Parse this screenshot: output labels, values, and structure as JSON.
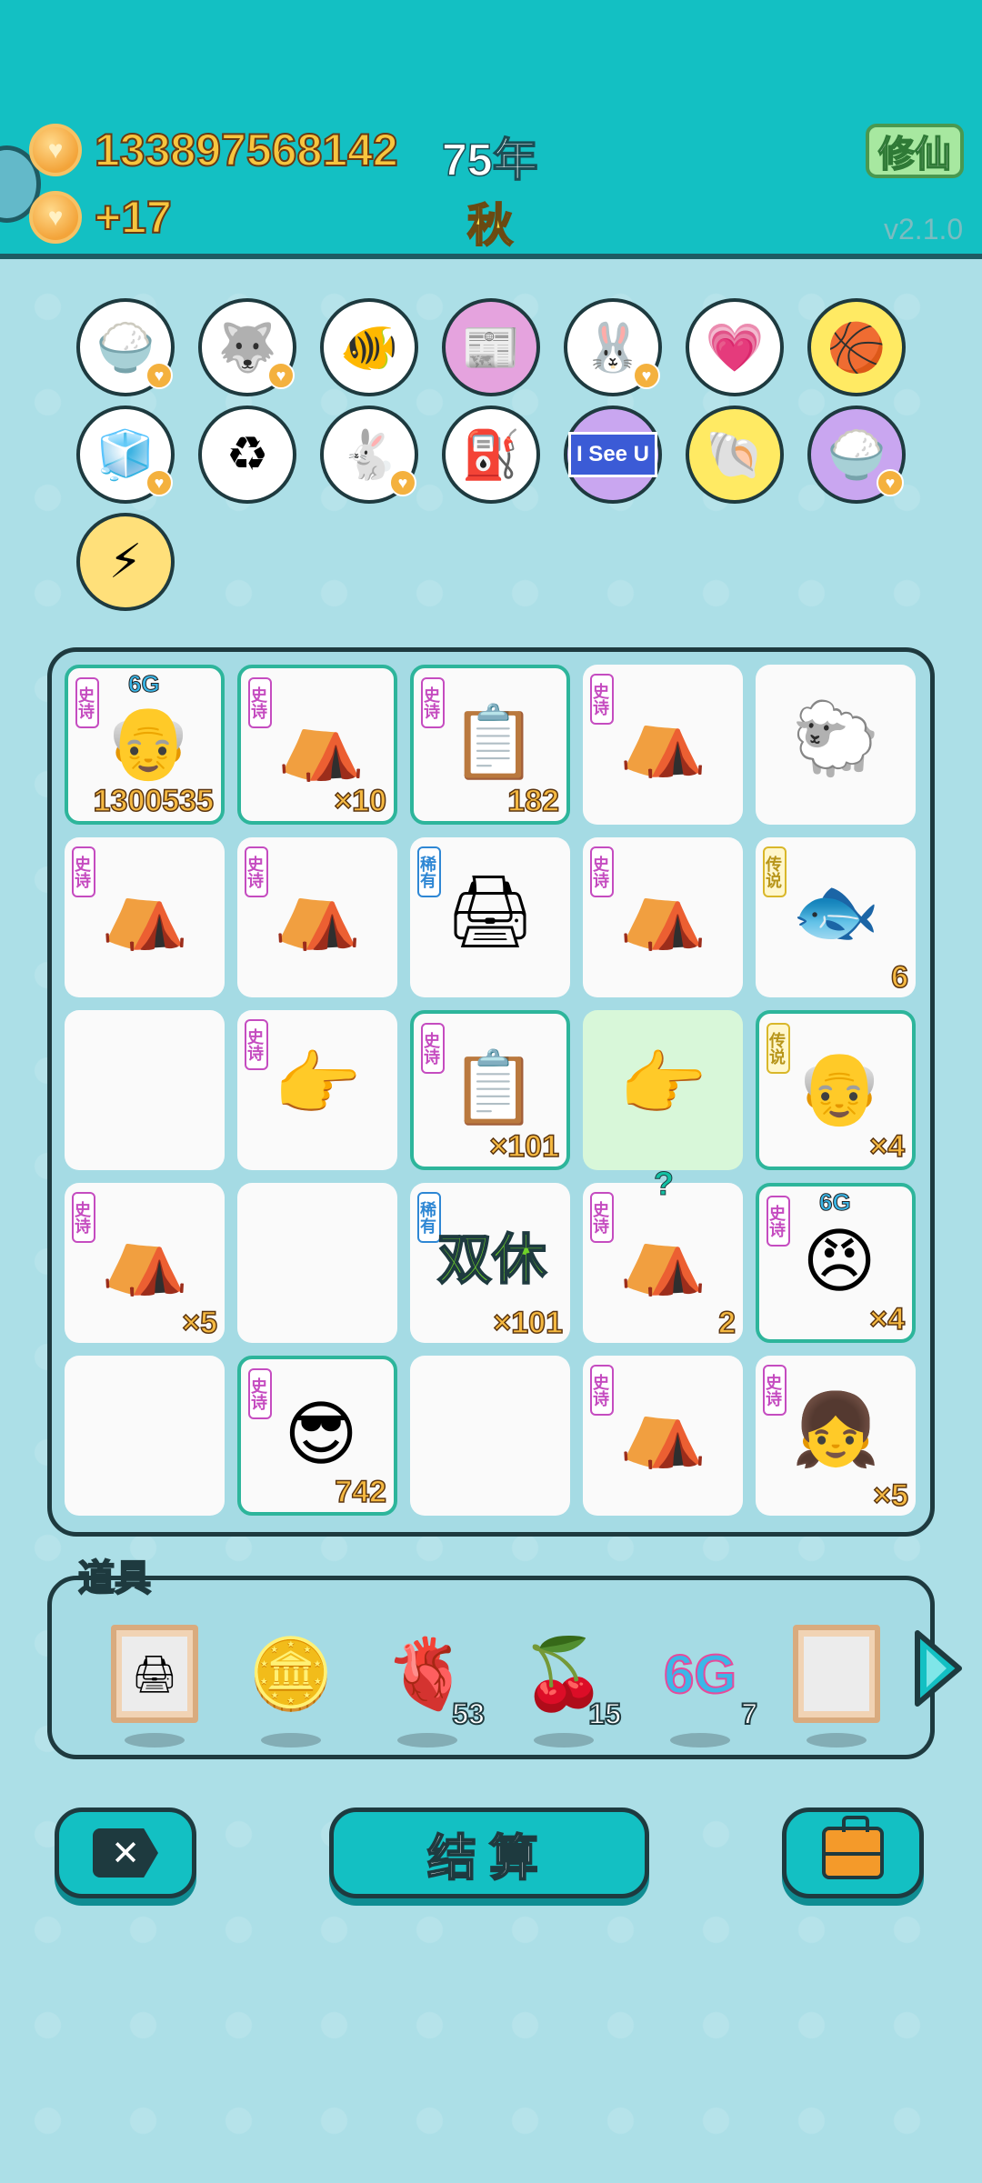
{
  "header": {
    "coins": "133897568142",
    "income": "+17",
    "year": "75年",
    "season": "秋",
    "cultivate_button": "修仙",
    "version": "v2.1.0"
  },
  "collection": [
    {
      "name": "rice-bowl-icon",
      "glyph": "🍚",
      "bg": "#ffffff",
      "heart": true
    },
    {
      "name": "husky-dog-icon",
      "glyph": "🐺",
      "bg": "#ffffff",
      "heart": true
    },
    {
      "name": "fish-tank-icon",
      "glyph": "🐠",
      "bg": "#ffffff",
      "heart": false
    },
    {
      "name": "time-magazine-icon",
      "glyph": "📰",
      "bg": "#e5a3de",
      "heart": false
    },
    {
      "name": "rabbit-icon",
      "glyph": "🐰",
      "bg": "#ffffff",
      "heart": true
    },
    {
      "name": "heart-fan-icon",
      "glyph": "💗",
      "bg": "#ffffff",
      "heart": false
    },
    {
      "name": "basketballs-icon",
      "glyph": "🏀",
      "bg": "#ffea63",
      "heart": false
    },
    {
      "name": "sugar-cubes-icon",
      "glyph": "🧊",
      "bg": "#ffffff",
      "heart": true
    },
    {
      "name": "recycle-bag-icon",
      "glyph": "♻",
      "bg": "#ffffff",
      "heart": false
    },
    {
      "name": "rabbit-icon",
      "glyph": "🐇",
      "bg": "#ffffff",
      "heart": true
    },
    {
      "name": "air-pump-icon",
      "glyph": "⛽",
      "bg": "#ffffff",
      "heart": false
    },
    {
      "name": "i-see-u-sign-icon",
      "glyph": "I See U",
      "bg": "#c9a6f0",
      "heart": false
    },
    {
      "name": "shell-icon",
      "glyph": "🐚",
      "bg": "#ffea63",
      "heart": false
    },
    {
      "name": "rice-bowl-icon",
      "glyph": "🍚",
      "bg": "#c9a6f0",
      "heart": true
    },
    {
      "name": "lightning-icon",
      "glyph": "⚡",
      "bg": "#ffe07a",
      "heart": false
    }
  ],
  "board": [
    {
      "name": "bald-uncle-king",
      "rarity": "史诗",
      "rarity_type": "epic",
      "glyph": "👴",
      "count": "1300535",
      "badge": "6G",
      "framed": true
    },
    {
      "name": "rabbit-tent",
      "rarity": "史诗",
      "rarity_type": "epic",
      "glyph": "⛺",
      "count": "×10",
      "framed": true
    },
    {
      "name": "ctrl-c-ctrl-v",
      "rarity": "史诗",
      "rarity_type": "epic",
      "glyph": "📋",
      "count": "182",
      "framed": true
    },
    {
      "name": "rabbit-tent",
      "rarity": "史诗",
      "rarity_type": "epic",
      "glyph": "⛺",
      "count": ""
    },
    {
      "name": "sheep",
      "rarity": "",
      "glyph": "🐑",
      "count": ""
    },
    {
      "name": "rabbit-tent",
      "rarity": "史诗",
      "rarity_type": "epic",
      "glyph": "⛺",
      "count": ""
    },
    {
      "name": "rabbit-tent",
      "rarity": "史诗",
      "rarity_type": "epic",
      "glyph": "⛺",
      "count": ""
    },
    {
      "name": "printer",
      "rarity": "稀有",
      "rarity_type": "rare",
      "glyph": "🖨",
      "count": ""
    },
    {
      "name": "rabbit-tent",
      "rarity": "史诗",
      "rarity_type": "epic",
      "glyph": "⛺",
      "count": ""
    },
    {
      "name": "koi-fish",
      "rarity": "传说",
      "rarity_type": "legend",
      "glyph": "🐟",
      "count": "6"
    },
    {
      "name": "empty",
      "rarity": "",
      "glyph": "",
      "count": ""
    },
    {
      "name": "pointing-hand-gray",
      "rarity": "史诗",
      "rarity_type": "epic",
      "glyph": "👉",
      "count": ""
    },
    {
      "name": "ctrl-c-ctrl-v",
      "rarity": "史诗",
      "rarity_type": "epic",
      "glyph": "📋",
      "count": "×101",
      "framed": true
    },
    {
      "name": "pointing-hand-gold",
      "rarity": "",
      "glyph": "👉",
      "count": "",
      "green": true
    },
    {
      "name": "golden-grandpa-king",
      "rarity": "传说",
      "rarity_type": "legend",
      "glyph": "👴",
      "count": "×4",
      "framed": true
    },
    {
      "name": "rabbit-tent",
      "rarity": "史诗",
      "rarity_type": "epic",
      "glyph": "⛺",
      "count": "×5"
    },
    {
      "name": "empty",
      "rarity": "",
      "glyph": "",
      "count": ""
    },
    {
      "name": "double-rest",
      "rarity": "稀有",
      "rarity_type": "rare",
      "glyph": "",
      "text": "双休",
      "count": "×101"
    },
    {
      "name": "rabbit-tent",
      "rarity": "史诗",
      "rarity_type": "epic",
      "glyph": "⛺",
      "count": "2",
      "question": "?"
    },
    {
      "name": "grumpy-king",
      "rarity": "史诗",
      "rarity_type": "epic",
      "glyph": "😠",
      "count": "×4",
      "badge": "6G",
      "framed": true
    },
    {
      "name": "empty",
      "rarity": "",
      "glyph": "",
      "count": ""
    },
    {
      "name": "green-hat-man",
      "rarity": "史诗",
      "rarity_type": "epic",
      "glyph": "😎",
      "count": "742",
      "framed": true
    },
    {
      "name": "empty",
      "rarity": "",
      "glyph": "",
      "count": ""
    },
    {
      "name": "rabbit-tent",
      "rarity": "史诗",
      "rarity_type": "epic",
      "glyph": "⛺",
      "count": ""
    },
    {
      "name": "braided-girl",
      "rarity": "史诗",
      "rarity_type": "epic",
      "glyph": "👧",
      "count": "×5"
    }
  ],
  "props": {
    "title": "道具",
    "items": [
      {
        "name": "printer-frame-prop",
        "glyph": "🖨",
        "count": "",
        "frame": true
      },
      {
        "name": "coin-prop",
        "glyph": "🪙",
        "count": ""
      },
      {
        "name": "liver-prop",
        "glyph": "🫀",
        "count": "53"
      },
      {
        "name": "bayberry-prop",
        "glyph": "🍒",
        "count": "15"
      },
      {
        "name": "6g-prop",
        "glyph": "6G",
        "count": "7"
      },
      {
        "name": "empty-frame-prop",
        "glyph": "",
        "count": "",
        "frame": true
      }
    ]
  },
  "buttons": {
    "settle": "结算"
  },
  "colors": {
    "header": "#13c0c3",
    "background": "#acdfe7",
    "outline": "#1e3a3f",
    "gold_text": "#f7c53e",
    "epic": "#c54cc0",
    "rare": "#2e87d4",
    "legend": "#d9b72a"
  }
}
